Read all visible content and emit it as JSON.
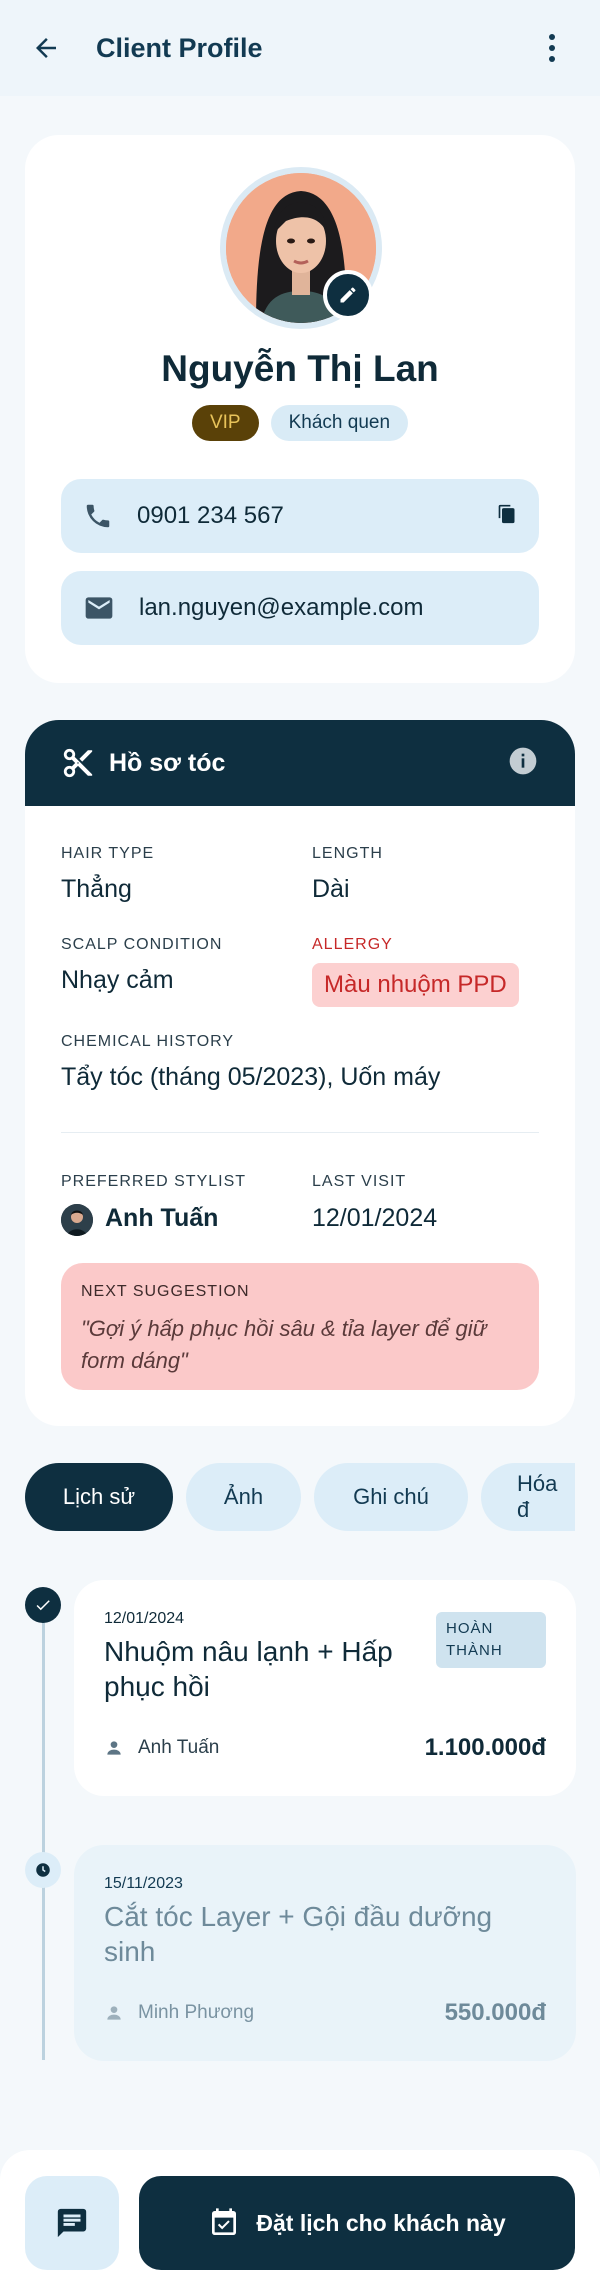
{
  "header": {
    "title": "Client Profile"
  },
  "profile": {
    "name": "Nguyễn Thị Lan",
    "badges": {
      "vip": "VIP",
      "regular": "Khách quen"
    },
    "phone": "0901 234 567",
    "email": "lan.nguyen@example.com"
  },
  "hair_profile": {
    "title": "Hồ sơ tóc",
    "hair_type_label": "HAIR TYPE",
    "hair_type": "Thẳng",
    "length_label": "LENGTH",
    "length": "Dài",
    "scalp_label": "SCALP CONDITION",
    "scalp": "Nhạy cảm",
    "allergy_label": "ALLERGY",
    "allergy": "Màu nhuộm PPD",
    "chemical_label": "CHEMICAL HISTORY",
    "chemical": "Tẩy tóc (tháng 05/2023), Uốn máy",
    "stylist_label": "PREFERRED STYLIST",
    "stylist": "Anh Tuấn",
    "last_visit_label": "LAST VISIT",
    "last_visit": "12/01/2024",
    "suggestion_label": "NEXT SUGGESTION",
    "suggestion": "\"Gợi ý hấp phục hồi sâu & tỉa layer để giữ form dáng\""
  },
  "tabs": [
    {
      "label": "Lịch sử"
    },
    {
      "label": "Ảnh"
    },
    {
      "label": "Ghi chú"
    },
    {
      "label": "Hóa đ"
    }
  ],
  "visits": [
    {
      "date": "12/01/2024",
      "title": "Nhuộm nâu lạnh + Hấp phục hồi",
      "status": "HOÀN THÀNH",
      "stylist": "Anh Tuấn",
      "price": "1.100.000đ"
    },
    {
      "date": "15/11/2023",
      "title": "Cắt tóc Layer + Gội đầu dưỡng sinh",
      "stylist": "Minh Phương",
      "price": "550.000đ"
    }
  ],
  "bottom": {
    "book_label": "Đặt lịch cho khách này"
  },
  "colors": {
    "primary": "#0e2f40",
    "accent_light": "#dcedf8",
    "danger": "#c62828",
    "vip": "#5a4108"
  }
}
